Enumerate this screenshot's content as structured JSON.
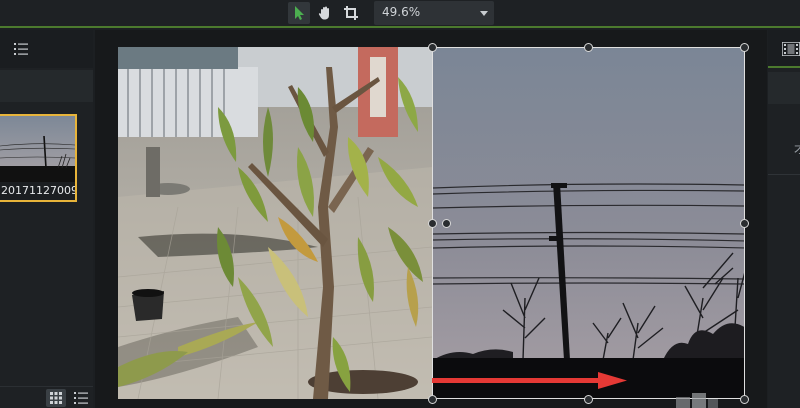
{
  "toolbar": {
    "tools": [
      {
        "name": "select",
        "icon": "arrow-pointer-icon",
        "active": true,
        "color": "#4caf50"
      },
      {
        "name": "pan",
        "icon": "hand-icon",
        "active": false
      },
      {
        "name": "crop",
        "icon": "crop-icon",
        "active": false
      }
    ],
    "zoom": {
      "value": "49.6%"
    }
  },
  "media_bin": {
    "items": [
      {
        "label": "20171127009...",
        "selected": true,
        "selection_color": "#e8b43a"
      }
    ],
    "view_modes": [
      "grid-view-icon",
      "list-view-icon"
    ]
  },
  "right_panel": {
    "peek_text": "才",
    "accent": "#4c7a2e"
  },
  "canvas": {
    "annotation_arrow_color": "#e53935"
  }
}
